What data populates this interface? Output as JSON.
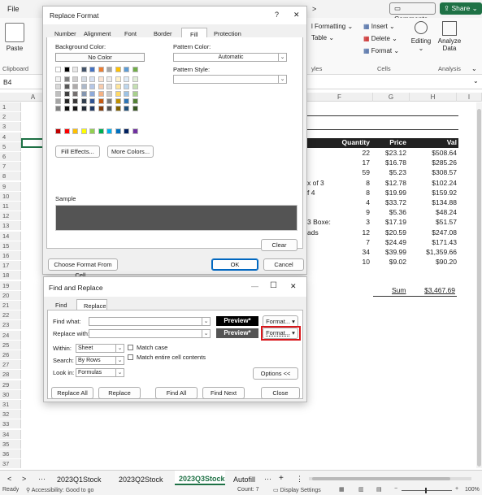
{
  "ribbon": {
    "tabs": {
      "file": "File",
      "partial": ">"
    },
    "comments": "Comments",
    "share": "Share",
    "paste": "Paste",
    "clipboard": "Clipboard",
    "styles": {
      "cond_format": "l Formatting",
      "table": "Table",
      "group": "yles"
    },
    "cells": {
      "insert": "Insert",
      "delete": "Delete",
      "format": "Format",
      "group": "Cells"
    },
    "editing": "Editing",
    "analyze": {
      "line1": "Analyze",
      "line2": "Data",
      "group": "Analysis"
    }
  },
  "namebox": "B4",
  "columns": {
    "a": "A",
    "f": "F",
    "g": "G",
    "h": "H",
    "i": "I"
  },
  "rows": [
    "1",
    "2",
    "3",
    "4",
    "5",
    "6",
    "7",
    "8",
    "9",
    "10",
    "11",
    "12",
    "13",
    "14",
    "15",
    "16",
    "17",
    "18",
    "19",
    "20",
    "21",
    "22",
    "23",
    "24",
    "25",
    "26",
    "27",
    "28",
    "29",
    "30",
    "31",
    "32",
    "33",
    "34",
    "35",
    "36",
    "37"
  ],
  "sheet": {
    "headers": {
      "qty": "Quantity",
      "price": "Price",
      "val": "Val"
    },
    "rows": [
      {
        "label": "",
        "qty": "22",
        "price": "$23.12",
        "val": "$508.64"
      },
      {
        "label": "",
        "qty": "17",
        "price": "$16.78",
        "val": "$285.26"
      },
      {
        "label": "",
        "qty": "59",
        "price": "$5.23",
        "val": "$308.57"
      },
      {
        "label": "x of 3",
        "qty": "8",
        "price": "$12.78",
        "val": "$102.24"
      },
      {
        "label": "f 4",
        "qty": "8",
        "price": "$19.99",
        "val": "$159.92"
      },
      {
        "label": "",
        "qty": "4",
        "price": "$33.72",
        "val": "$134.88"
      },
      {
        "label": "",
        "qty": "9",
        "price": "$5.36",
        "val": "$48.24"
      },
      {
        "label": "3 Boxe:",
        "qty": "3",
        "price": "$17.19",
        "val": "$51.57"
      },
      {
        "label": "ads",
        "qty": "12",
        "price": "$20.59",
        "val": "$247.08"
      },
      {
        "label": "",
        "qty": "7",
        "price": "$24.49",
        "val": "$171.43"
      },
      {
        "label": "",
        "qty": "34",
        "price": "$39.99",
        "val": "$1,359.66"
      },
      {
        "label": "",
        "qty": "10",
        "price": "$9.02",
        "val": "$90.20"
      }
    ],
    "sum_label": "Sum",
    "sum_value": "$3,467.69"
  },
  "replace_format": {
    "title": "Replace Format",
    "help": "?",
    "close": "✕",
    "tabs": [
      "Number",
      "Alignment",
      "Font",
      "Border",
      "Fill",
      "Protection"
    ],
    "bg_color_label": "Background Color:",
    "no_color": "No Color",
    "pattern_color_label": "Pattern Color:",
    "pattern_color_value": "Automatic",
    "pattern_style_label": "Pattern Style:",
    "fill_effects": "Fill Effects...",
    "more_colors": "More Colors...",
    "sample_label": "Sample",
    "sample_color": "#545454",
    "clear": "Clear",
    "choose_from_cell": "Choose Format From Cell...",
    "ok": "OK",
    "cancel": "Cancel"
  },
  "palette": {
    "row1": [
      "#ffffff",
      "#000000",
      "#e7e6e6",
      "#44546a",
      "#4472c4",
      "#ed7d31",
      "#a5a5a5",
      "#ffc000",
      "#5b9bd5",
      "#70ad47"
    ],
    "tints": [
      [
        "#f2f2f2",
        "#7f7f7f",
        "#d0cece",
        "#d6dce4",
        "#d9e2f3",
        "#fbe5d5",
        "#ededed",
        "#fff2cc",
        "#deebf6",
        "#e2efd9"
      ],
      [
        "#d8d8d8",
        "#595959",
        "#aeabab",
        "#adb9ca",
        "#b4c6e7",
        "#f7cbac",
        "#dbdbdb",
        "#fee599",
        "#bdd7ee",
        "#c5e0b3"
      ],
      [
        "#bfbfbf",
        "#3f3f3f",
        "#757070",
        "#8496b0",
        "#8eaadb",
        "#f4b183",
        "#c9c9c9",
        "#ffd965",
        "#9cc3e5",
        "#a8d08d"
      ],
      [
        "#a5a5a5",
        "#262626",
        "#3a3838",
        "#323f4f",
        "#2f5496",
        "#c55a11",
        "#7b7b7b",
        "#bf9000",
        "#2e75b5",
        "#538135"
      ],
      [
        "#7f7f7f",
        "#0c0c0c",
        "#171616",
        "#222a35",
        "#1f3864",
        "#833c0b",
        "#525252",
        "#7f6000",
        "#1e4e79",
        "#375623"
      ]
    ],
    "standard": [
      "#c00000",
      "#ff0000",
      "#ffc000",
      "#ffff00",
      "#92d050",
      "#00b050",
      "#00b0f0",
      "#0070c0",
      "#002060",
      "#7030a0"
    ]
  },
  "find_replace": {
    "title": "Find and Replace",
    "tab_find": "Find",
    "tab_replace": "Replace",
    "find_what": "Find what:",
    "replace_with": "Replace with:",
    "preview": "Preview*",
    "format": "Format...",
    "within_label": "Within:",
    "within_value": "Sheet",
    "search_label": "Search:",
    "search_value": "By Rows",
    "look_label": "Look in:",
    "look_value": "Formulas",
    "match_case": "Match case",
    "match_entire": "Match entire cell contents",
    "options": "Options <<",
    "replace_all": "Replace All",
    "replace": "Replace",
    "find_all": "Find All",
    "find_next": "Find Next",
    "close": "Close",
    "minimize": "—",
    "maximize": "☐",
    "x": "✕"
  },
  "sheets": {
    "prev": "<",
    "next": ">",
    "more": "···",
    "tabs": [
      "2023Q1Stock",
      "2023Q2Stock",
      "2023Q3Stock",
      "Autofill"
    ],
    "add": "+",
    "menu": "⋮"
  },
  "status": {
    "ready": "Ready",
    "accessibility": "Accessibility: Good to go",
    "count": "Count: 7",
    "display": "Display Settings",
    "zoom": "100%"
  },
  "colors": {
    "accent_green": "#1e7145",
    "highlight": "#d9161b"
  }
}
